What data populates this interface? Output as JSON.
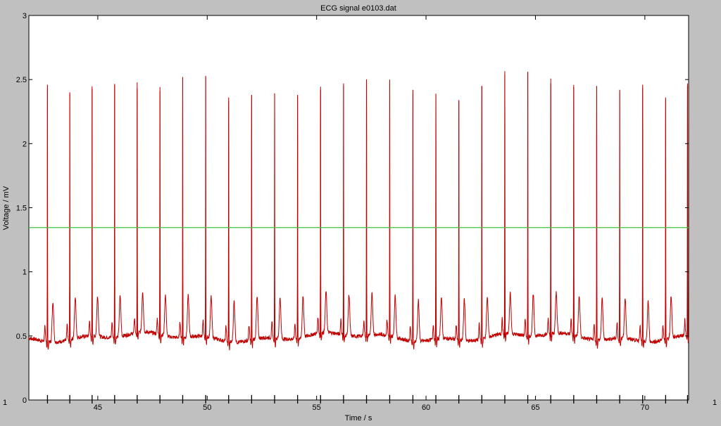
{
  "window": {
    "left_edge_label": "1",
    "right_edge_label": "1"
  },
  "chart_data": {
    "type": "line",
    "title": "ECG signal e0103.dat",
    "xlabel": "Time / s",
    "ylabel": "Voltage / mV",
    "xlim": [
      41.85,
      72.0
    ],
    "ylim": [
      0,
      3
    ],
    "xticks": [
      45,
      50,
      55,
      60,
      65,
      70
    ],
    "yticks": [
      0,
      0.5,
      1,
      1.5,
      2,
      2.5,
      3
    ],
    "grid": false,
    "series": [
      {
        "color": "#c00000",
        "style": "ecg",
        "baseline": 0.49,
        "r_peaks": [
          {
            "t": 42.7,
            "v": 2.46
          },
          {
            "t": 43.72,
            "v": 2.4
          },
          {
            "t": 44.74,
            "v": 2.43
          },
          {
            "t": 45.77,
            "v": 2.46
          },
          {
            "t": 46.8,
            "v": 2.43
          },
          {
            "t": 47.84,
            "v": 2.41
          },
          {
            "t": 48.88,
            "v": 2.52
          },
          {
            "t": 49.93,
            "v": 2.52
          },
          {
            "t": 50.98,
            "v": 2.36
          },
          {
            "t": 52.03,
            "v": 2.38
          },
          {
            "t": 53.08,
            "v": 2.39
          },
          {
            "t": 54.13,
            "v": 2.38
          },
          {
            "t": 55.18,
            "v": 2.42
          },
          {
            "t": 56.23,
            "v": 2.45
          },
          {
            "t": 57.28,
            "v": 2.49
          },
          {
            "t": 58.34,
            "v": 2.48
          },
          {
            "t": 59.4,
            "v": 2.42
          },
          {
            "t": 60.45,
            "v": 2.39
          },
          {
            "t": 61.5,
            "v": 2.34
          },
          {
            "t": 62.55,
            "v": 2.45
          },
          {
            "t": 63.6,
            "v": 2.54
          },
          {
            "t": 64.65,
            "v": 2.56
          },
          {
            "t": 65.7,
            "v": 2.47
          },
          {
            "t": 66.75,
            "v": 2.44
          },
          {
            "t": 67.8,
            "v": 2.45
          },
          {
            "t": 68.85,
            "v": 2.42
          },
          {
            "t": 69.9,
            "v": 2.46
          },
          {
            "t": 70.95,
            "v": 2.36
          },
          {
            "t": 71.95,
            "v": 2.45
          }
        ],
        "t_wave_peak": 0.81,
        "t_wave_delay": 0.25
      },
      {
        "color": "#40c040",
        "style": "constant",
        "value": 1.345
      }
    ]
  }
}
